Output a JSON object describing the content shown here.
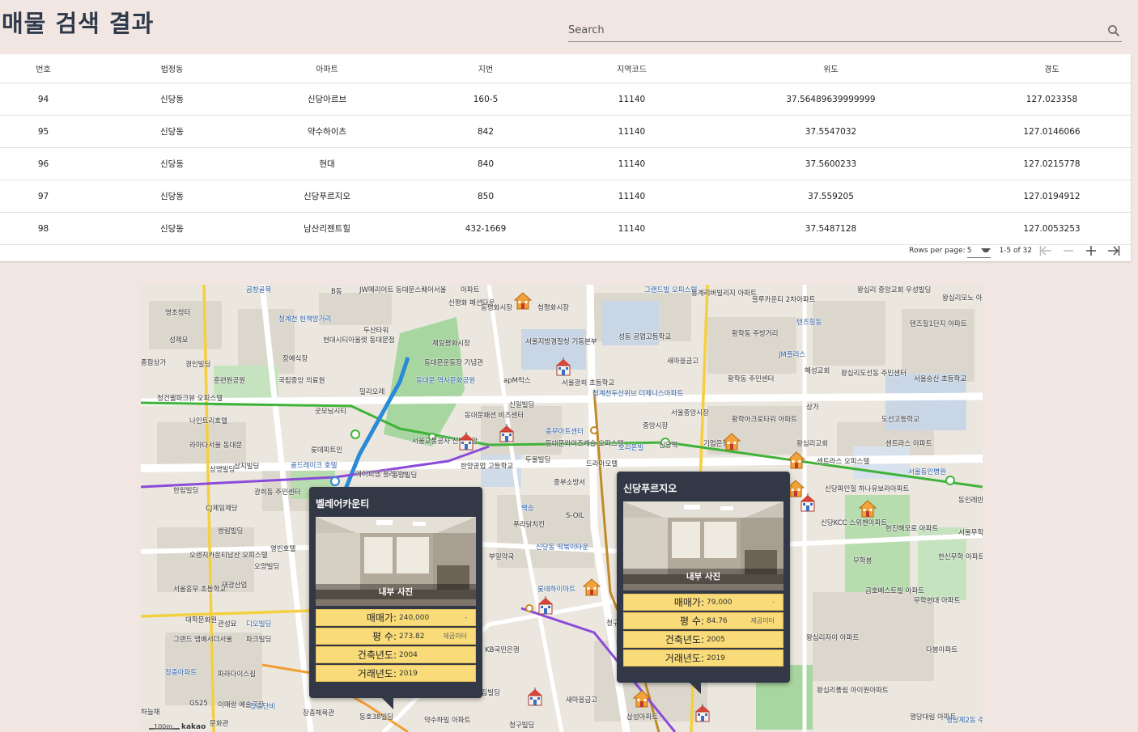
{
  "header": {
    "title": "매물 검색 결과",
    "search_placeholder": "Search"
  },
  "table": {
    "columns": [
      "번호",
      "법정동",
      "아파트",
      "지번",
      "지역코드",
      "위도",
      "경도"
    ],
    "rows": [
      [
        "94",
        "신당동",
        "신당아르브",
        "160-5",
        "11140",
        "37.56489639999999",
        "127.023358"
      ],
      [
        "95",
        "신당동",
        "약수하이츠",
        "842",
        "11140",
        "37.5547032",
        "127.0146066"
      ],
      [
        "96",
        "신당동",
        "현대",
        "840",
        "11140",
        "37.5600233",
        "127.0215778"
      ],
      [
        "97",
        "신당동",
        "신당푸르지오",
        "850",
        "11140",
        "37.559205",
        "127.0194912"
      ],
      [
        "98",
        "신당동",
        "남산리젠트힐",
        "432-1669",
        "11140",
        "37.5487128",
        "127.0053253"
      ]
    ]
  },
  "pagination": {
    "rows_per_page_label": "Rows per page:",
    "rows_per_page_value": "5",
    "range_text": "1-5 of 32"
  },
  "map": {
    "scale_label": "100m",
    "provider_label": "kakao",
    "labels": [
      "곱창골목",
      "B동",
      "JW메리어트 동대문스퀘어서울",
      "아파트",
      "신평화 패션타운",
      "동평화시장",
      "청평화시장",
      "그랜드빌 오피스텔",
      "동계리버빌리지 아파트",
      "블루카운티 2차아파트",
      "왕십리 중앙교회",
      "우성빌딩",
      "왕십리모노 아파트",
      "영초청터",
      "청계천 헌책방거리",
      "두산타워",
      "현대시티아울렛 동대문점",
      "제일평화시장",
      "서울지방경찰청 기동본부",
      "성동 공업고등학교",
      "황학동 주방거리",
      "텐즈힐동",
      "텐즈힐1단지 아파트",
      "성제묘",
      "경인빌딩",
      "장예식장",
      "동대문운동장 기념관",
      "새마을금고",
      "JM플러스",
      "혜성교회",
      "왕십리도선동 주민센터",
      "서울숭신 초등학교",
      "종합상가",
      "훈련원공원",
      "국립중앙 의료원",
      "동대문 역사문화공원",
      "apM럭스",
      "서울광희 초등학교",
      "황학동 주민센터",
      "청건웰파크뷰 오피스텔",
      "밀리오레",
      "신일빌딩",
      "청계천두산위브 더제니스아파트",
      "서울중앙시장",
      "상가",
      "도선고등학교",
      "나인트리호텔",
      "굿모닝시티",
      "동대문패션 비즈센터",
      "충무아트센터",
      "중앙시장",
      "황학아크로타워 아파트",
      "라마다서울 동대문",
      "롯데피트인",
      "서울교통공사 신당별관",
      "동대문와이즈캐슬 오피스텔",
      "오리온빌",
      "신당역",
      "기업은행",
      "왕십리교회",
      "센트라스 아파트",
      "상명빌딩",
      "삼지빌딩",
      "골드레이크 호텔",
      "에이피엠 플레이스",
      "동양빌딩",
      "한양공업 고등학교",
      "두울빌딩",
      "드라마모텔",
      "센트라스 오피스텔",
      "서울동인병원",
      "한림빌딩",
      "광희동 주민센터",
      "중부소방서",
      "신당파인힐 하나유보라아파트",
      "동인레반트 오피스텔",
      "CJ제일제당",
      "백승",
      "푸라닭치킨",
      "S-OIL",
      "신당KCC 스위첸아파트",
      "한진해모로 아파트",
      "서울무학 초등학교",
      "쌍림빌딩",
      "신당동 떡볶이타운",
      "무학봉",
      "한신무학 아파트",
      "오렌지카운티남산 오피스텔",
      "영빈호텔",
      "부일약국",
      "오양빌딩",
      "롯데하이마트",
      "태광산업",
      "서울흥무 초등학교",
      "금호베스트빌 아파트",
      "무학현대 아파트",
      "청구e편한세상 아파트",
      "관성묘",
      "디오빌딩",
      "대학문화원",
      "파크빌딩",
      "그랜드 앰배서더서울",
      "KB국민은행",
      "왕십리자이 아파트",
      "다봉아파트",
      "장충아파트",
      "파라다이스집",
      "S집빌딩",
      "새마을금고",
      "왕십리풍림 아이원아파트",
      "GS25",
      "이매랑 예술극장",
      "장충단비",
      "장충체육관",
      "동호38빌딩",
      "약수하빌 아파트",
      "청구빌딩",
      "삼성아파트",
      "행당대림 아파트",
      "행당제2동 주민센터",
      "하늘채",
      "문화관"
    ]
  },
  "overlays": [
    {
      "title": "벨레어카운티",
      "photo_caption": "내부 사진",
      "rows": [
        {
          "label": "매매가:",
          "value": "240,000",
          "extra": "-"
        },
        {
          "label": "평 수:",
          "value": "273.82",
          "extra": "제곱미터"
        },
        {
          "label": "건축년도:",
          "value": "2004",
          "extra": ""
        },
        {
          "label": "거래년도:",
          "value": "2019",
          "extra": ""
        }
      ]
    },
    {
      "title": "신당푸르지오",
      "photo_caption": "내부 사진",
      "rows": [
        {
          "label": "매매가:",
          "value": "79,000",
          "extra": "-"
        },
        {
          "label": "평 수:",
          "value": "84.76",
          "extra": "제곱미터"
        },
        {
          "label": "건축년도:",
          "value": "2005",
          "extra": ""
        },
        {
          "label": "거래년도:",
          "value": "2019",
          "extra": ""
        }
      ]
    }
  ],
  "icons": {
    "search": "search-icon",
    "first_page": "first-page-icon",
    "prev_page": "minus-icon",
    "next_page": "plus-icon",
    "last_page": "last-page-icon",
    "school_marker": "school-marker-icon",
    "house_marker": "house-marker-icon"
  },
  "colors": {
    "background": "#f1e6e1",
    "title": "#2e3a4c",
    "overlay_bg": "#333846",
    "info_row": "#f9dc79",
    "line2_green": "#3fb339",
    "line4_blue": "#2a8ad8",
    "line5_purple": "#8b4bd8",
    "line6_brown": "#c08a2a"
  }
}
